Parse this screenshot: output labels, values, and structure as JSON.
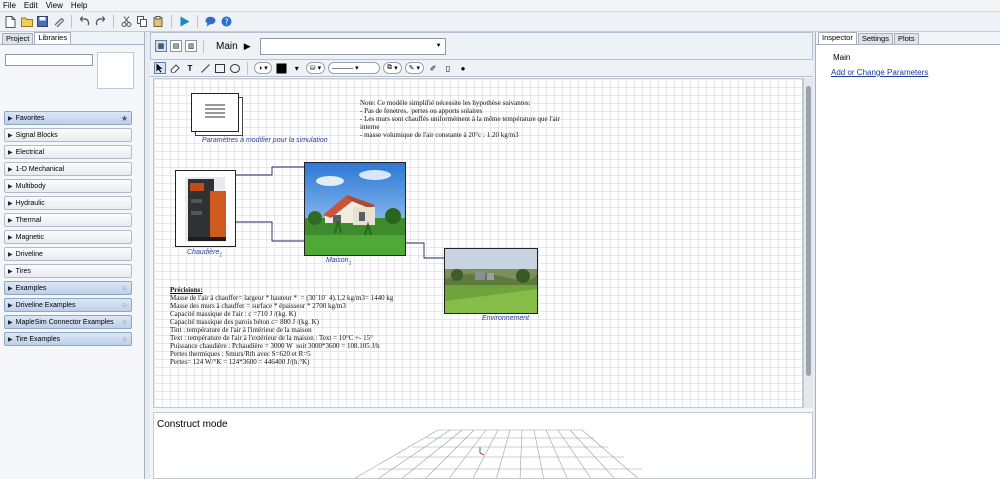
{
  "menu": [
    "File",
    "Edit",
    "View",
    "Help"
  ],
  "left": {
    "tabs": [
      "Project",
      "Libraries"
    ],
    "items": [
      {
        "label": "Favorites",
        "hl": true,
        "icon": "★"
      },
      {
        "label": "Signal Blocks",
        "hl": false,
        "icon": ""
      },
      {
        "label": "Electrical",
        "hl": false,
        "icon": ""
      },
      {
        "label": "1-D Mechanical",
        "hl": false,
        "icon": ""
      },
      {
        "label": "Multibody",
        "hl": false,
        "icon": ""
      },
      {
        "label": "Hydraulic",
        "hl": false,
        "icon": ""
      },
      {
        "label": "Thermal",
        "hl": false,
        "icon": ""
      },
      {
        "label": "Magnetic",
        "hl": false,
        "icon": ""
      },
      {
        "label": "Driveline",
        "hl": false,
        "icon": ""
      },
      {
        "label": "Tires",
        "hl": false,
        "icon": ""
      },
      {
        "label": "Examples",
        "hl": true,
        "icon": "⁘"
      },
      {
        "label": "Driveline Examples",
        "hl": true,
        "icon": "⁘"
      },
      {
        "label": "MapleSim Connector Examples",
        "hl": true,
        "icon": "⁘"
      },
      {
        "label": "Tire Examples",
        "hl": true,
        "icon": "⁘"
      }
    ]
  },
  "nav": {
    "title": "Main",
    "arrow": "▶"
  },
  "canvas": {
    "params_label": "Paramètres à modifier pour la simulation",
    "chaudiere_label": "Chaudière",
    "maison_label": "Maison",
    "env_label": "Environnement",
    "subscript": "1",
    "note": "Note: Ce modèle simplifié nécessite les hypothèse suivantes:\n- Pas de fenetres,  pertes ou apports solaires\n- Les murs sont chauffés uniformément à la même température que l'air\ninterne\n- masse volumique de l'air constante à 20°c : 1.20 kg/m3",
    "precisions_title": "Précisions:",
    "precisions": "Masse de l'air à chauffer= largeur * hauteur *  = (30`10` 4).1,2 kg/m3= 1440 kg\nMasse des murs à chauffer = surface * épaisseur * 2700 kg/m3\nCapacité massique de l'air : c =710 J /(kg. K)\nCapacité massique des parois béton c= 880 J /(kg. K)\nTint : température de l'air à l'intérieur de la maison\nText : température de l'air à l'extérieur de la maison : Text = 10°C +- 15°\nPuissance chaudière : Pchaudière = 3000 W  soit 3000*3600 = 108.105 J/h\nPertes thermiques : Smurs/Rth avec S=620 et R=5\nPertes= 124 W/°K = 124*3600 = 446400 J/(h.°K)"
  },
  "construct_mode": "Construct mode",
  "right": {
    "tabs": [
      "Inspector",
      "Settings",
      "Plots"
    ],
    "main": "Main",
    "link": "Add or Change Parameters"
  },
  "colors": {
    "accent": "#2a3f9c",
    "wire": "#1f2a55"
  }
}
